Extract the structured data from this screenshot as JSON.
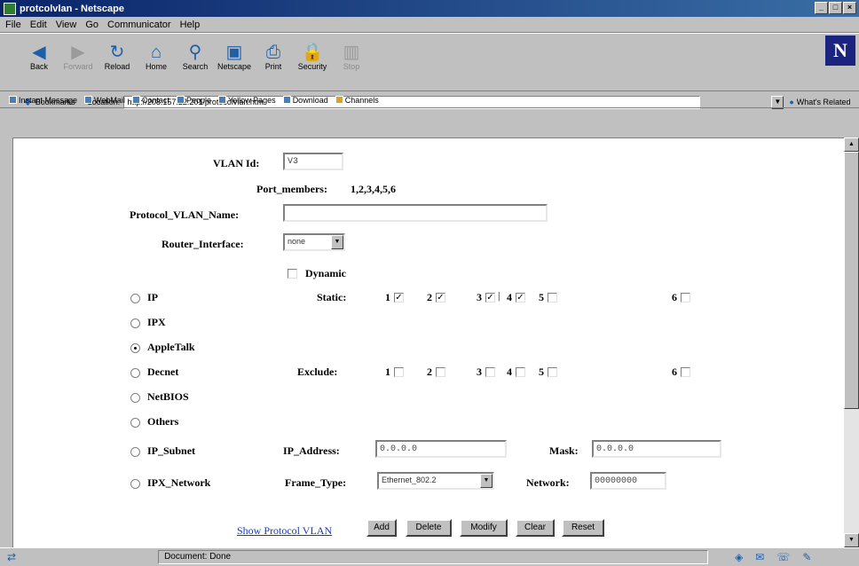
{
  "window": {
    "title": "protcolvlan - Netscape",
    "controls": [
      "_",
      "□",
      "×"
    ]
  },
  "menu": [
    "File",
    "Edit",
    "View",
    "Go",
    "Communicator",
    "Help"
  ],
  "toolbar": {
    "buttons": [
      {
        "label": "Back",
        "icon": "back-arrow-icon",
        "glyph": "◀"
      },
      {
        "label": "Forward",
        "icon": "forward-arrow-icon",
        "glyph": "▶"
      },
      {
        "label": "Reload",
        "icon": "reload-icon",
        "glyph": "↻"
      },
      {
        "label": "Home",
        "icon": "home-icon",
        "glyph": "⌂"
      },
      {
        "label": "Search",
        "icon": "search-icon",
        "glyph": "⚲"
      },
      {
        "label": "Netscape",
        "icon": "netscape-icon",
        "glyph": "▣"
      },
      {
        "label": "Print",
        "icon": "print-icon",
        "glyph": "⎙"
      },
      {
        "label": "Security",
        "icon": "security-icon",
        "glyph": "🔒"
      },
      {
        "label": "Stop",
        "icon": "stop-icon",
        "glyph": "▥"
      }
    ],
    "logo": "N"
  },
  "location": {
    "bookmarks_label": "Bookmarks",
    "location_label": "Location:",
    "url": "http://208.157.22.201/protocolvlan.htm",
    "related_label": "What's Related"
  },
  "personal_toolbar": [
    "Instant Message",
    "WebMail",
    "Contact",
    "People",
    "Yellow Pages",
    "Download",
    "Channels"
  ],
  "form": {
    "vlan_id_label": "VLAN Id:",
    "vlan_id_value": "V3",
    "port_members_label": "Port_members:",
    "port_members_value": "1,2,3,4,5,6",
    "protocol_vlan_name_label": "Protocol_VLAN_Name:",
    "protocol_vlan_name_value": "",
    "router_interface_label": "Router_Interface:",
    "router_interface_value": "none",
    "dynamic_label": "Dynamic",
    "dynamic_checked": false,
    "protocols": [
      {
        "label": "IP",
        "selected": false
      },
      {
        "label": "IPX",
        "selected": false
      },
      {
        "label": "AppleTalk",
        "selected": true
      },
      {
        "label": "Decnet",
        "selected": false
      },
      {
        "label": "NetBIOS",
        "selected": false
      },
      {
        "label": "Others",
        "selected": false
      },
      {
        "label": "IP_Subnet",
        "selected": false
      },
      {
        "label": "IPX_Network",
        "selected": false
      }
    ],
    "static_label": "Static:",
    "static_ports": [
      {
        "port": "1",
        "checked": true
      },
      {
        "port": "2",
        "checked": true
      },
      {
        "port": "3",
        "checked": true
      },
      {
        "port": "4",
        "checked": true
      },
      {
        "port": "5",
        "checked": false
      },
      {
        "port": "6",
        "checked": false
      }
    ],
    "exclude_label": "Exclude:",
    "exclude_ports": [
      {
        "port": "1",
        "checked": false
      },
      {
        "port": "2",
        "checked": false
      },
      {
        "port": "3",
        "checked": false
      },
      {
        "port": "4",
        "checked": false
      },
      {
        "port": "5",
        "checked": false
      },
      {
        "port": "6",
        "checked": false
      }
    ],
    "ip_address_label": "IP_Address:",
    "ip_address_value": "0.0.0.0",
    "mask_label": "Mask:",
    "mask_value": "0.0.0.0",
    "frame_type_label": "Frame_Type:",
    "frame_type_value": "Ethernet_802.2",
    "network_label": "Network:",
    "network_value": "00000000",
    "show_link": "Show Protocol VLAN",
    "buttons": [
      "Add",
      "Delete",
      "Modify",
      "Clear",
      "Reset"
    ]
  },
  "status": {
    "text": "Document: Done"
  },
  "check_glyph": "✓"
}
